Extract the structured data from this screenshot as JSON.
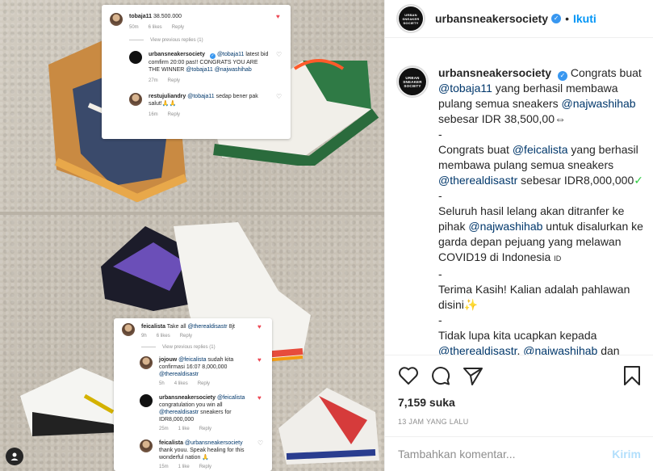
{
  "account": {
    "username": "urbansneakersociety",
    "logo_text": [
      "URBAN",
      "SNEAKER",
      "SOCIETY"
    ],
    "follow_label": "Ikuti",
    "separator": "•"
  },
  "caption": {
    "intro": " Congrats buat ",
    "m1": "@tobaja11",
    "t1": " yang berhasil membawa pulang semua sneakers ",
    "m2": "@najwashihab",
    "t2": " sebesar IDR 38,500,00",
    "t2_icon": "⇔",
    "dash1": "-",
    "t3": "Congrats buat ",
    "m3": "@feicalista",
    "t4": " yang berhasil membawa pulang semua sneakers ",
    "m4": "@therealdisastr",
    "t5": " sebesar IDR8,000,000",
    "t5_icon": "✓",
    "dash2": "-",
    "t6": "Seluruh hasil lelang akan ditranfer ke pihak ",
    "m5": "@najwashihab",
    "t7": " untuk disalurkan ke garda depan pejuang yang melawan COVID19 di Indonesia ",
    "t7_icon": "ID",
    "dash3": "-",
    "t8": "Terima Kasih! Kalian adalah pahlawan disini",
    "t8_icon": "✨",
    "dash4": "-",
    "t9": "Tidak lupa kita ucapkan kepada ",
    "m6": "@therealdisastr",
    "t10": ", ",
    "m7": "@najwashihab",
    "t11": " dan"
  },
  "actions": {
    "likes": "7,159 suka",
    "time": "13 JAM YANG LALU"
  },
  "comment_box": {
    "placeholder": "Tambahkan komentar...",
    "post_label": "Kirim"
  },
  "card_top": {
    "c1_user": "tobaja11",
    "c1_text": " 38.500.000",
    "c1_time": "50m",
    "c1_likes": "6 likes",
    "c1_reply": "Reply",
    "view_prev": "View previous replies (1)",
    "c2_user": "urbansneakersociety",
    "c2_mention": "@tobaja11",
    "c2_text": " latest bid comfirm 20:00 pas!! CONGRATS YOU ARE THE WINNER ",
    "c2_mention2": "@tobaja11",
    "c2_mention3": "@najwashihab",
    "c2_time": "27m",
    "c2_reply": "Reply",
    "c3_user": "restujuliandry",
    "c3_mention": "@tobaja11",
    "c3_text": " sedap bener pak salut!",
    "c3_icon": "🙏🙏",
    "c3_time": "16m",
    "c3_reply": "Reply"
  },
  "card_bottom": {
    "c1_user": "feicalista",
    "c1_text": " Take all ",
    "c1_mention": "@therealdisastr",
    "c1_text2": " 8jt",
    "c1_time": "9h",
    "c1_likes": "6 likes",
    "c1_reply": "Reply",
    "view_prev": "View previous replies (1)",
    "c2_user": "jojouw",
    "c2_mention": "@feicalista",
    "c2_text": " sudah kita confirmasi 16:07  8,000,000 ",
    "c2_mention2": "@therealdisastr",
    "c2_time": "5h",
    "c2_likes": "4 likes",
    "c2_reply": "Reply",
    "c3_user": "urbansneakersociety",
    "c3_mention": "@feicalista",
    "c3_text": " congratulation you win all ",
    "c3_mention2": "@therealdisastr",
    "c3_text2": " sneakers for IDR8,000,000",
    "c3_time": "25m",
    "c3_likes": "1 like",
    "c3_reply": "Reply",
    "c4_user": "feicalista",
    "c4_mention": "@urbansneakersociety",
    "c4_text": " thank youu. Speak healing for this wonderful nation ",
    "c4_icon": "🙏",
    "c4_time": "15m",
    "c4_likes": "1 like",
    "c4_reply": "Reply"
  },
  "colors": {
    "accent": "#0095f6",
    "verified": "#3897f0",
    "mention": "#00376b",
    "muted": "#8e8e8e",
    "like_red": "#ed4956"
  }
}
